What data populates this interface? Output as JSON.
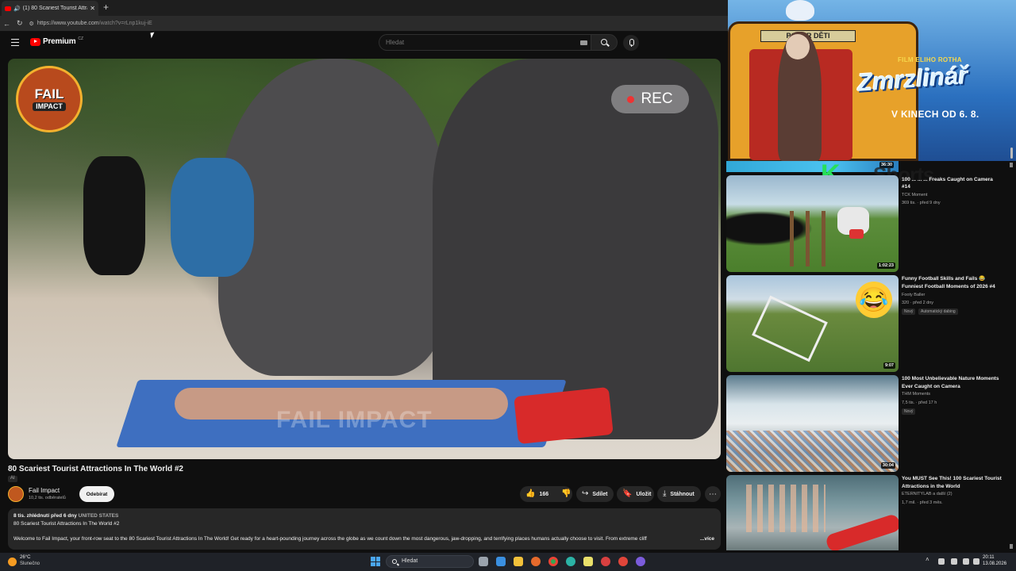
{
  "browser": {
    "tab_title": "(1) 80 Scariest Tourist Attracti",
    "url_host": "https://www.youtube.com",
    "url_path": "/watch?v=rLnp1kuj-iE"
  },
  "header": {
    "logo_text": "Premium",
    "logo_region": "CZ",
    "search_placeholder": "Hledat"
  },
  "player": {
    "channel_badge_l1": "FAIL",
    "channel_badge_l2": "IMPACT",
    "rec_label": "REC",
    "watermark": "FAIL IMPACT"
  },
  "video": {
    "title": "80 Scariest Tourist Attractions In The World #2",
    "ai_tag": "AI",
    "channel_name": "Fail Impact",
    "subscribers": "10,2 tis. odběratelů",
    "subscribe_label": "Odebírat",
    "likes": "166",
    "share_label": "Sdílet",
    "save_label": "Uložit",
    "download_label": "Stáhnout",
    "more_label": "⋯",
    "desc_views": "8 tis. zhlédnutí",
    "desc_date": "před 6 dny",
    "desc_location": "UNITED STATES",
    "desc_line2": "80 Scariest Tourist Attractions In The World #2",
    "desc_body": "Welcome to Fail Impact, your front-row seat to the 80 Scariest Tourist Attractions In The World! Get ready for a heart-pounding journey across the globe as we count down the most dangerous, jaw-dropping, and terrifying places humans actually choose to visit. From extreme cliff",
    "desc_more": "...více"
  },
  "ad": {
    "sign": "POZOR DĚTI",
    "film_label": "FILM ELIHO ROTHA",
    "title": "Zmrzlinář",
    "date": "V KINECH OD 6. 8."
  },
  "recommendations": [
    {
      "title": "100 Most Unbelievable Freak Accidents Caught on Camera #14",
      "title_visible": "100 ... ... ... Freaks Caught on Camera #14",
      "channel": "TCK Moment",
      "meta": "369 tis. · před 9 dny",
      "duration": "36:30",
      "overlay": "Shorts"
    },
    {
      "title": "Funny Football Skills and Fails 😂 Funniest Football Moments of 2026 #4",
      "channel": "Footy Baller",
      "meta": "320 · před 2 dny",
      "badges": [
        "Nový",
        "Automatický dabing"
      ],
      "duration": "1:02:23"
    },
    {
      "title": "100 Most Unbelievable Nature Moments Ever Caught on Camera",
      "channel": "THM Moments",
      "meta": "7,5 tis. · před 17 h",
      "badges": [
        "Nový"
      ],
      "duration": "9:07"
    },
    {
      "title": "You MUST See This! 100 Scariest Tourist Attractions in the World",
      "channel": "ETERNITYLAB a další (2)",
      "meta": "1,7 mil. · před 3 měs.",
      "duration": "30:04"
    }
  ],
  "taskbar": {
    "temp": "26°C",
    "condition": "Slunečno",
    "search_label": "Hledat",
    "time": "20:11",
    "date": "13.08.2026"
  }
}
